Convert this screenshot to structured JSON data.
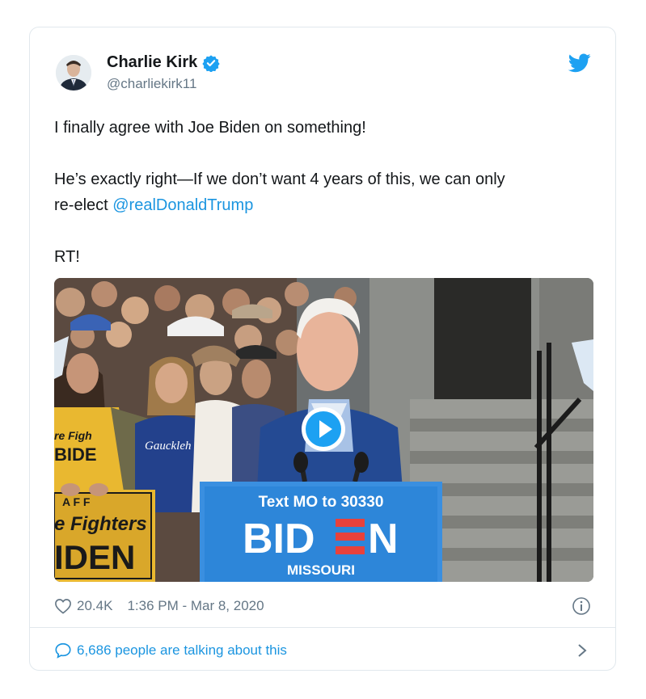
{
  "author": {
    "name": "Charlie Kirk",
    "handle": "@charliekirk11",
    "verified": true
  },
  "tweet": {
    "line1": "I finally agree with Joe Biden on something!",
    "line2a": "He’s exactly right—If we don’t want 4 years of this, we can only",
    "line2b": "re-elect ",
    "mention": "@realDonaldTrump",
    "line3": "RT!"
  },
  "media": {
    "sign_top": "Text MO to 30330",
    "sign_main_left": "BID",
    "sign_main_right": "N",
    "sign_bottom": "MISSOURI",
    "left_sign_top": "A F F",
    "left_sign_mid": "e Fighters",
    "left_sign_bottom": "IDEN",
    "shirt_text": "re Figh",
    "shirt_text2": "BIDE",
    "blue_shirt_text": "Gauckleh"
  },
  "meta": {
    "likes": "20.4K",
    "timestamp": "1:36 PM - Mar 8, 2020"
  },
  "footer": {
    "talking": "6,686 people are talking about this"
  },
  "colors": {
    "link": "#1b95e0",
    "secondary": "#657786",
    "border": "#e1e8ed",
    "sign_blue": "#2d86d9",
    "sign_red": "#e8413b"
  },
  "icons": [
    "verified-badge-icon",
    "twitter-bird-icon",
    "play-icon",
    "heart-icon",
    "info-icon",
    "speech-bubble-icon",
    "chevron-right-icon"
  ]
}
